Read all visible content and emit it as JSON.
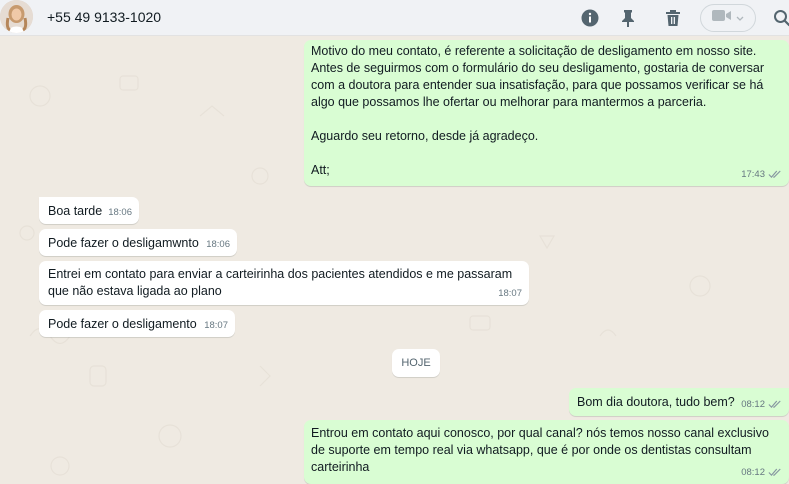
{
  "header": {
    "contact_name": "+55 49 9133-1020",
    "icons": [
      "info-icon",
      "pin-icon",
      "trash-icon",
      "video-call-icon",
      "search-icon"
    ]
  },
  "messages": [
    {
      "direction": "out",
      "text": "Motivo do meu contato, é referente a solicitação de desligamento em nosso site. Antes de seguirmos com o formulário do seu desligamento, gostaria de conversar com a doutora para entender sua insatisfação, para que possamos verificar se há algo que possamos lhe ofertar ou melhorar para mantermos a parceria.\n\nAguardo seu retorno, desde já agradeço.\n\nAtt;",
      "time": "17:43",
      "status": "read"
    },
    {
      "direction": "in",
      "text": "Boa tarde",
      "time": "18:06"
    },
    {
      "direction": "in",
      "text": "Pode fazer o desligamwnto",
      "time": "18:06"
    },
    {
      "direction": "in",
      "text": "Entrei em contato para enviar a carteirinha dos pacientes atendidos e me passaram que não estava ligada ao plano",
      "time": "18:07"
    },
    {
      "direction": "in",
      "text": "Pode fazer o desligamento",
      "time": "18:07"
    },
    {
      "direction": "out",
      "text": "Bom dia doutora, tudo bem?",
      "time": "08:12",
      "status": "read"
    },
    {
      "direction": "out",
      "text": "Entrou em contato aqui conosco, por qual canal? nós temos nosso canal exclusivo de suporte em tempo real via whatsapp, que é por onde os dentistas consultam carteirinha",
      "time": "08:12",
      "status": "read"
    }
  ],
  "day_divider": "HOJE",
  "colors": {
    "outgoing_bubble": "#d9fdd3",
    "incoming_bubble": "#ffffff",
    "chat_background": "#efeae2",
    "header_background": "#f0f2f5",
    "read_tick": "#8696a0"
  }
}
